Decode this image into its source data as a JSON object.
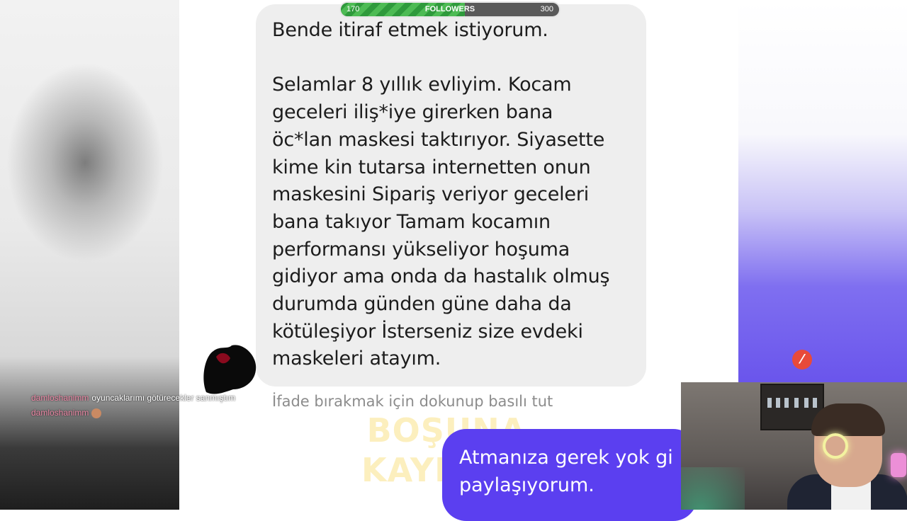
{
  "followers_goal": {
    "title": "FOLLOWERS",
    "current": "170",
    "target": "300",
    "progress": 0.567
  },
  "conversation": {
    "received_message": "Bende itiraf etmek istiyorum.\n\nSelamlar 8 yıllık evliyim. Kocam\ngeceleri iliş*iye girerken bana\nöc*lan maskesi taktırıyor. Siyasette\nkime kin tutarsa internetten onun\nmaskesini Sipariş veriyor geceleri\nbana takıyor Tamam kocamın\nperformansı yükseliyor hoşuma\ngidiyor ama onda da hastalık olmuş\ndurumda günden güne daha da\nkötüleşiyor İsterseniz size evdeki\nmaskeleri atayım.",
    "reaction_hint": "İfade bırakmak için dokunup basılı tut",
    "sent_message": "Atmanıza gerek yok gi\npaylaşıyorum."
  },
  "watermark": "BOŞUNA\nKAYDIRMA",
  "chat": [
    {
      "user": "damloshanimm",
      "message": "oyuncaklarımı götürecekler sanmıştım"
    },
    {
      "user": "damloshanimm",
      "message": ""
    }
  ],
  "colors": {
    "sent_bubble": "#5b3ff0",
    "received_bubble": "#eeeeee",
    "progress_fill": "#3faa47",
    "chat_username": "#f08aa8"
  },
  "icons": {
    "streamlabs_logo": "slash-circle-icon",
    "chat_emoji": "emoji-icon"
  }
}
